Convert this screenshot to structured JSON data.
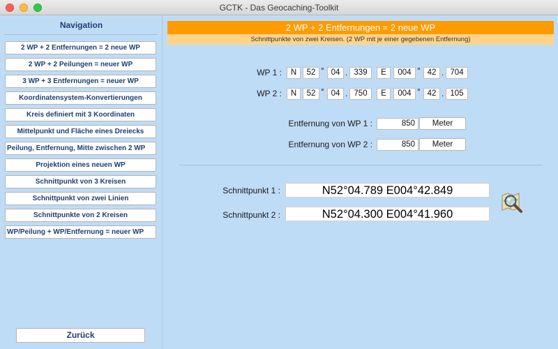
{
  "window": {
    "title": "GCTK - Das Geocaching-Toolkit"
  },
  "sidebar": {
    "title": "Navigation",
    "items": [
      {
        "label": "2 WP + 2 Entfernungen = 2 neue WP"
      },
      {
        "label": "2 WP + 2 Peilungen = neuer WP"
      },
      {
        "label": "3 WP + 3 Entfernungen = neuer WP"
      },
      {
        "label": "Koordinatensystem-Konvertierungen"
      },
      {
        "label": "Kreis definiert mit 3 Koordinaten"
      },
      {
        "label": "Mittelpunkt und Fläche eines Dreiecks"
      },
      {
        "label": "Peilung, Entfernung, Mitte zwischen 2 WP"
      },
      {
        "label": "Projektion eines neuen WP"
      },
      {
        "label": "Schnittpunkt von 3 Kreisen"
      },
      {
        "label": "Schnittpunkt von zwei Linien"
      },
      {
        "label": "Schnittpunkte von 2 Kreisen"
      },
      {
        "label": "WP/Peilung + WP/Entfernung = neuer WP"
      }
    ],
    "back_label": "Zurück"
  },
  "main": {
    "title": "2 WP + 2 Entfernungen = 2 neue WP",
    "subtitle": "Schnittpunkte von zwei Kreisen. (2 WP mit je einer gegebenen Entfernung)",
    "wp1": {
      "label": "WP 1 :",
      "ns": "N",
      "lat_deg": "52",
      "lat_min": "04",
      "lat_dec": "339",
      "ew": "E",
      "lon_deg": "004",
      "lon_min": "42",
      "lon_dec": "704"
    },
    "wp2": {
      "label": "WP 2 :",
      "ns": "N",
      "lat_deg": "52",
      "lat_min": "04",
      "lat_dec": "750",
      "ew": "E",
      "lon_deg": "004",
      "lon_min": "42",
      "lon_dec": "105"
    },
    "degree_symbol": "°",
    "dot": ".",
    "dist1": {
      "label": "Entfernung von WP 1 :",
      "value": "850",
      "unit": "Meter"
    },
    "dist2": {
      "label": "Entfernung von WP 2 :",
      "value": "850",
      "unit": "Meter"
    },
    "result1": {
      "label": "Schnittpunkt 1 :",
      "value": "N52°04.789  E004°42.849"
    },
    "result2": {
      "label": "Schnittpunkt 2 :",
      "value": "N52°04.300  E004°41.960"
    },
    "map_icon": "map-magnifier-icon"
  },
  "colors": {
    "accent_orange": "#ff9a00",
    "sub_bar": "#ffd48a",
    "background": "#bfdcf6",
    "nav_text": "#1f3f70"
  }
}
